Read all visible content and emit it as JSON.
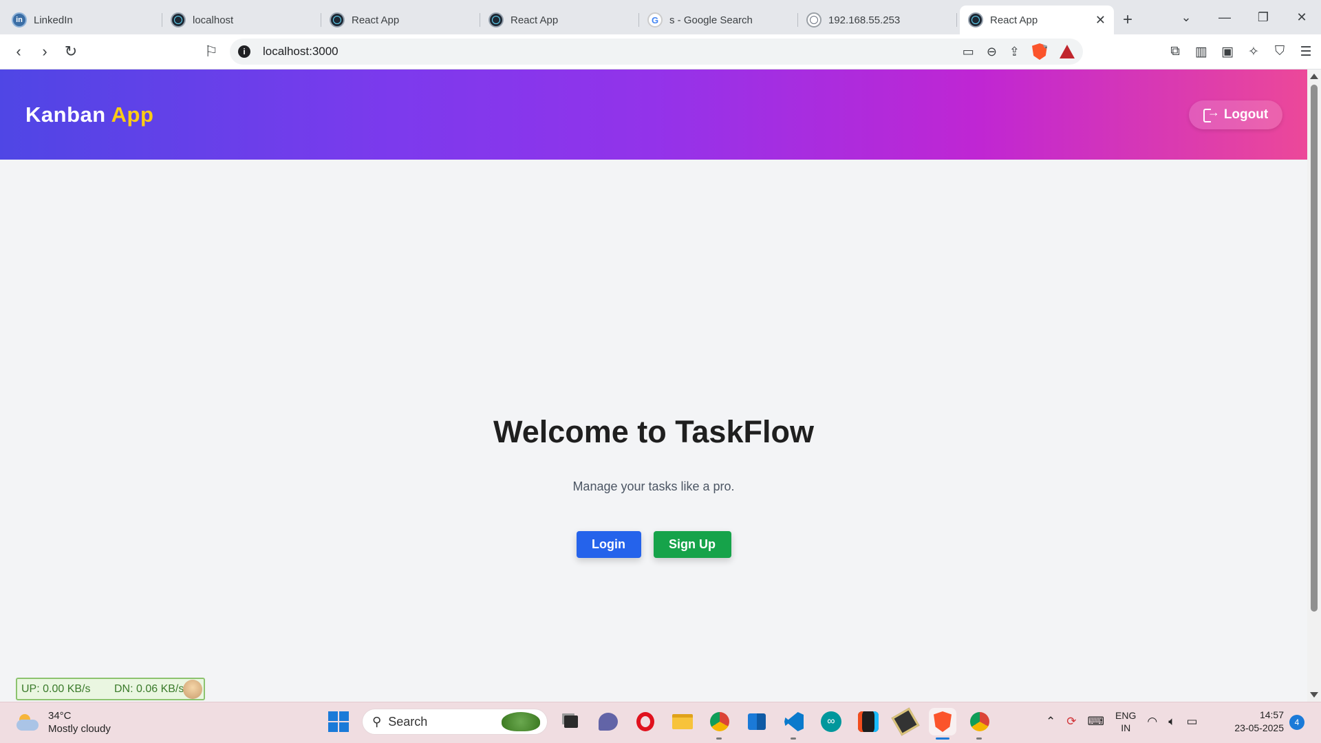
{
  "browser": {
    "tabs": [
      {
        "title": "LinkedIn",
        "icon": "linkedin-icon"
      },
      {
        "title": "localhost",
        "icon": "react-icon"
      },
      {
        "title": "React App",
        "icon": "react-icon"
      },
      {
        "title": "React App",
        "icon": "react-icon"
      },
      {
        "title": "s - Google Search",
        "icon": "google-icon"
      },
      {
        "title": "192.168.55.253",
        "icon": "globe-icon"
      },
      {
        "title": "React App",
        "icon": "react-icon",
        "active": true
      }
    ],
    "url": "localhost:3000",
    "shields_badge": "1"
  },
  "app": {
    "brand_main": "Kanban",
    "brand_accent": "App",
    "logout_label": "Logout",
    "welcome_title": "Welcome to TaskFlow",
    "subtitle": "Manage your tasks like a pro.",
    "login_label": "Login",
    "signup_label": "Sign Up",
    "colors": {
      "header_gradient_start": "#4f46e5",
      "header_gradient_end": "#ec4899",
      "brand_accent": "#facc15",
      "login_button": "#2563eb",
      "signup_button": "#16a34a"
    }
  },
  "netspeed": {
    "up": "UP: 0.00 KB/s",
    "down": "DN: 0.06 KB/s"
  },
  "taskbar": {
    "weather_temp": "34°C",
    "weather_desc": "Mostly cloudy",
    "search_label": "Search",
    "lang_top": "ENG",
    "lang_bottom": "IN",
    "time": "14:57",
    "date": "23-05-2025",
    "notification_count": "4"
  }
}
